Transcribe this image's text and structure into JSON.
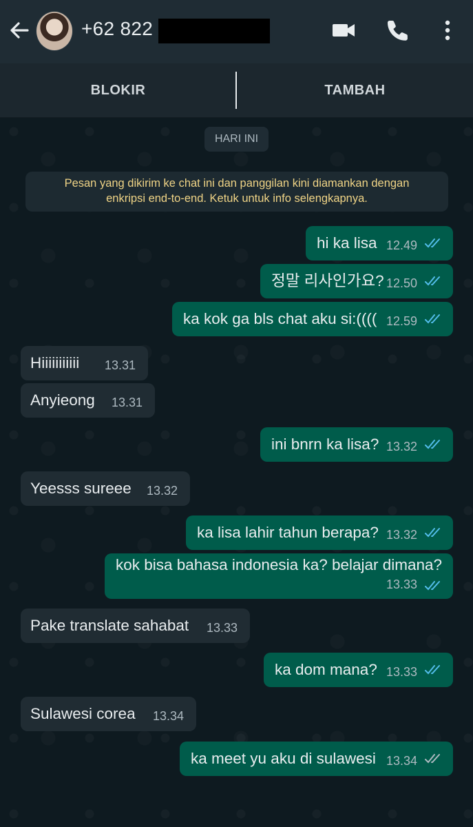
{
  "header": {
    "contact": "+62 822",
    "icons": [
      "back-arrow-icon",
      "video-call-icon",
      "phone-icon",
      "more-menu-icon"
    ]
  },
  "actions": {
    "block": "BLOKIR",
    "add": "TAMBAH"
  },
  "chat": {
    "date_label": "HARI INI",
    "notice_line1": "Pesan yang dikirim ke chat ini dan panggilan kini diamankan dengan",
    "notice_line2": "enkripsi end-to-end. Ketuk untuk info selengkapnya.",
    "messages": [
      {
        "dir": "out",
        "text": "hi ka lisa",
        "time": "12.49",
        "status": "read"
      },
      {
        "dir": "out",
        "text": "정말 리사인가요?",
        "time": "12.50",
        "status": "read"
      },
      {
        "dir": "out",
        "text": "ka kok ga bls chat aku si:((((",
        "time": "12.59",
        "status": "read"
      },
      {
        "dir": "in",
        "text": "Hiiiiiiiiiii",
        "time": "13.31"
      },
      {
        "dir": "in",
        "text": "Anyieong",
        "time": "13.31"
      },
      {
        "dir": "out",
        "text": "ini bnrn ka lisa?",
        "time": "13.32",
        "status": "read"
      },
      {
        "dir": "in",
        "text": "Yeesss sureee",
        "time": "13.32"
      },
      {
        "dir": "out",
        "text": "ka lisa lahir tahun berapa?",
        "time": "13.32",
        "status": "read"
      },
      {
        "dir": "out",
        "text": "kok bisa bahasa indonesia ka? belajar dimana?",
        "time": "13.33",
        "status": "read"
      },
      {
        "dir": "in",
        "text": "Pake translate sahabat",
        "time": "13.33"
      },
      {
        "dir": "out",
        "text": "ka dom mana?",
        "time": "13.33",
        "status": "read"
      },
      {
        "dir": "in",
        "text": "Sulawesi corea",
        "time": "13.34"
      },
      {
        "dir": "out",
        "text": "ka meet yu aku di sulawesi",
        "time": "13.34",
        "status": "delivered"
      }
    ]
  },
  "colors": {
    "header_bg": "#1f2c34",
    "outgoing_bubble": "#005c4b",
    "incoming_bubble": "#202c33",
    "read_tick": "#53bdeb",
    "delivered_tick": "#aebac1",
    "notice_text": "#f0d486"
  }
}
